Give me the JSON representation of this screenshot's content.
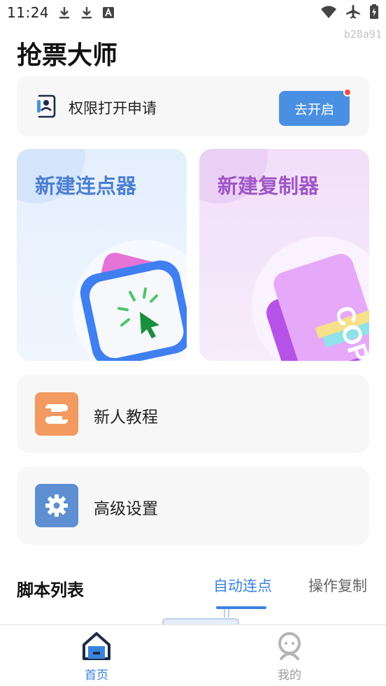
{
  "status_bar": {
    "time": "11:24",
    "left_icons": [
      "download-icon",
      "download-icon",
      "autofill-icon"
    ],
    "right_icons": [
      "wifi-icon",
      "airplane-icon",
      "battery-charging-icon"
    ]
  },
  "device_id": "b28a91",
  "app_title": "抢票大师",
  "permission": {
    "label": "权限打开申请",
    "button_label": "去开启",
    "badge_color": "#f04a4a"
  },
  "features": {
    "clicker": {
      "title": "新建连点器"
    },
    "copier": {
      "title": "新建复制器",
      "art_text": "COPY"
    }
  },
  "menu": {
    "tutorial": {
      "label": "新人教程",
      "icon": "tutorial-icon",
      "color": "#f29a5f"
    },
    "settings": {
      "label": "高级设置",
      "icon": "gear-icon",
      "color": "#5d8fd2"
    }
  },
  "scripts": {
    "title": "脚本列表",
    "tabs": [
      {
        "label": "自动连点",
        "active": true
      },
      {
        "label": "操作复制",
        "active": false
      }
    ]
  },
  "bottom_nav": [
    {
      "label": "首页",
      "icon": "home-icon",
      "active": true
    },
    {
      "label": "我的",
      "icon": "profile-icon",
      "active": false
    }
  ],
  "colors": {
    "accent": "#3a84e0",
    "button": "#4a90e2",
    "clicker_title": "#4b7fd1",
    "copier_title": "#a056c6"
  }
}
